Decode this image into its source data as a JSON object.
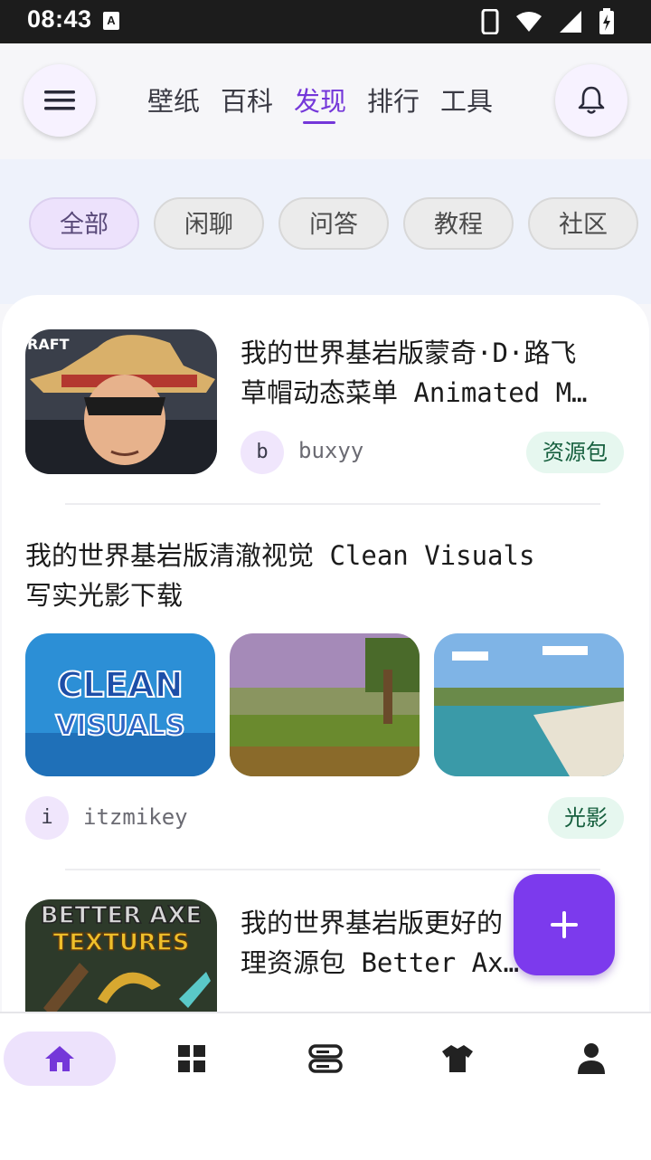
{
  "status_bar": {
    "time": "08:43",
    "notification_badge": "A"
  },
  "header": {
    "tabs": [
      {
        "label": "壁纸",
        "active": false
      },
      {
        "label": "百科",
        "active": false
      },
      {
        "label": "发现",
        "active": true
      },
      {
        "label": "排行",
        "active": false
      },
      {
        "label": "工具",
        "active": false
      }
    ]
  },
  "filters": [
    {
      "label": "全部",
      "active": true
    },
    {
      "label": "闲聊",
      "active": false
    },
    {
      "label": "问答",
      "active": false
    },
    {
      "label": "教程",
      "active": false
    },
    {
      "label": "社区",
      "active": false
    }
  ],
  "posts": [
    {
      "title_line1": "我的世界基岩版蒙奇·D·路飞",
      "title_line2": "草帽动态菜单 Animated M…",
      "avatar_letter": "b",
      "author": "buxyy",
      "tag": "资源包",
      "image_text": "RAFT"
    },
    {
      "title_line1": "我的世界基岩版清澈视觉 Clean Visuals",
      "title_line2": "写实光影下载",
      "thumb1_line1": "CLEAN",
      "thumb1_line2": "VISUALS",
      "avatar_letter": "i",
      "author": "itzmikey",
      "tag": "光影"
    },
    {
      "title_line1": "我的世界基岩版更好的",
      "title_line1_end": "理",
      "title_line2": "理资源包 Better Ax…",
      "image_line1": "BETTER AXE",
      "image_line2": "TEXTURES"
    }
  ],
  "colors": {
    "accent": "#7c3aed",
    "tab_active": "#7437d9",
    "tag_bg": "#e6f7ef",
    "tag_text": "#17603f"
  },
  "icons": {
    "menu": "hamburger-icon",
    "bell": "bell-icon",
    "fab": "plus-icon",
    "nav": [
      "home-icon",
      "grid-icon",
      "list-icon",
      "shirt-icon",
      "person-icon"
    ]
  }
}
